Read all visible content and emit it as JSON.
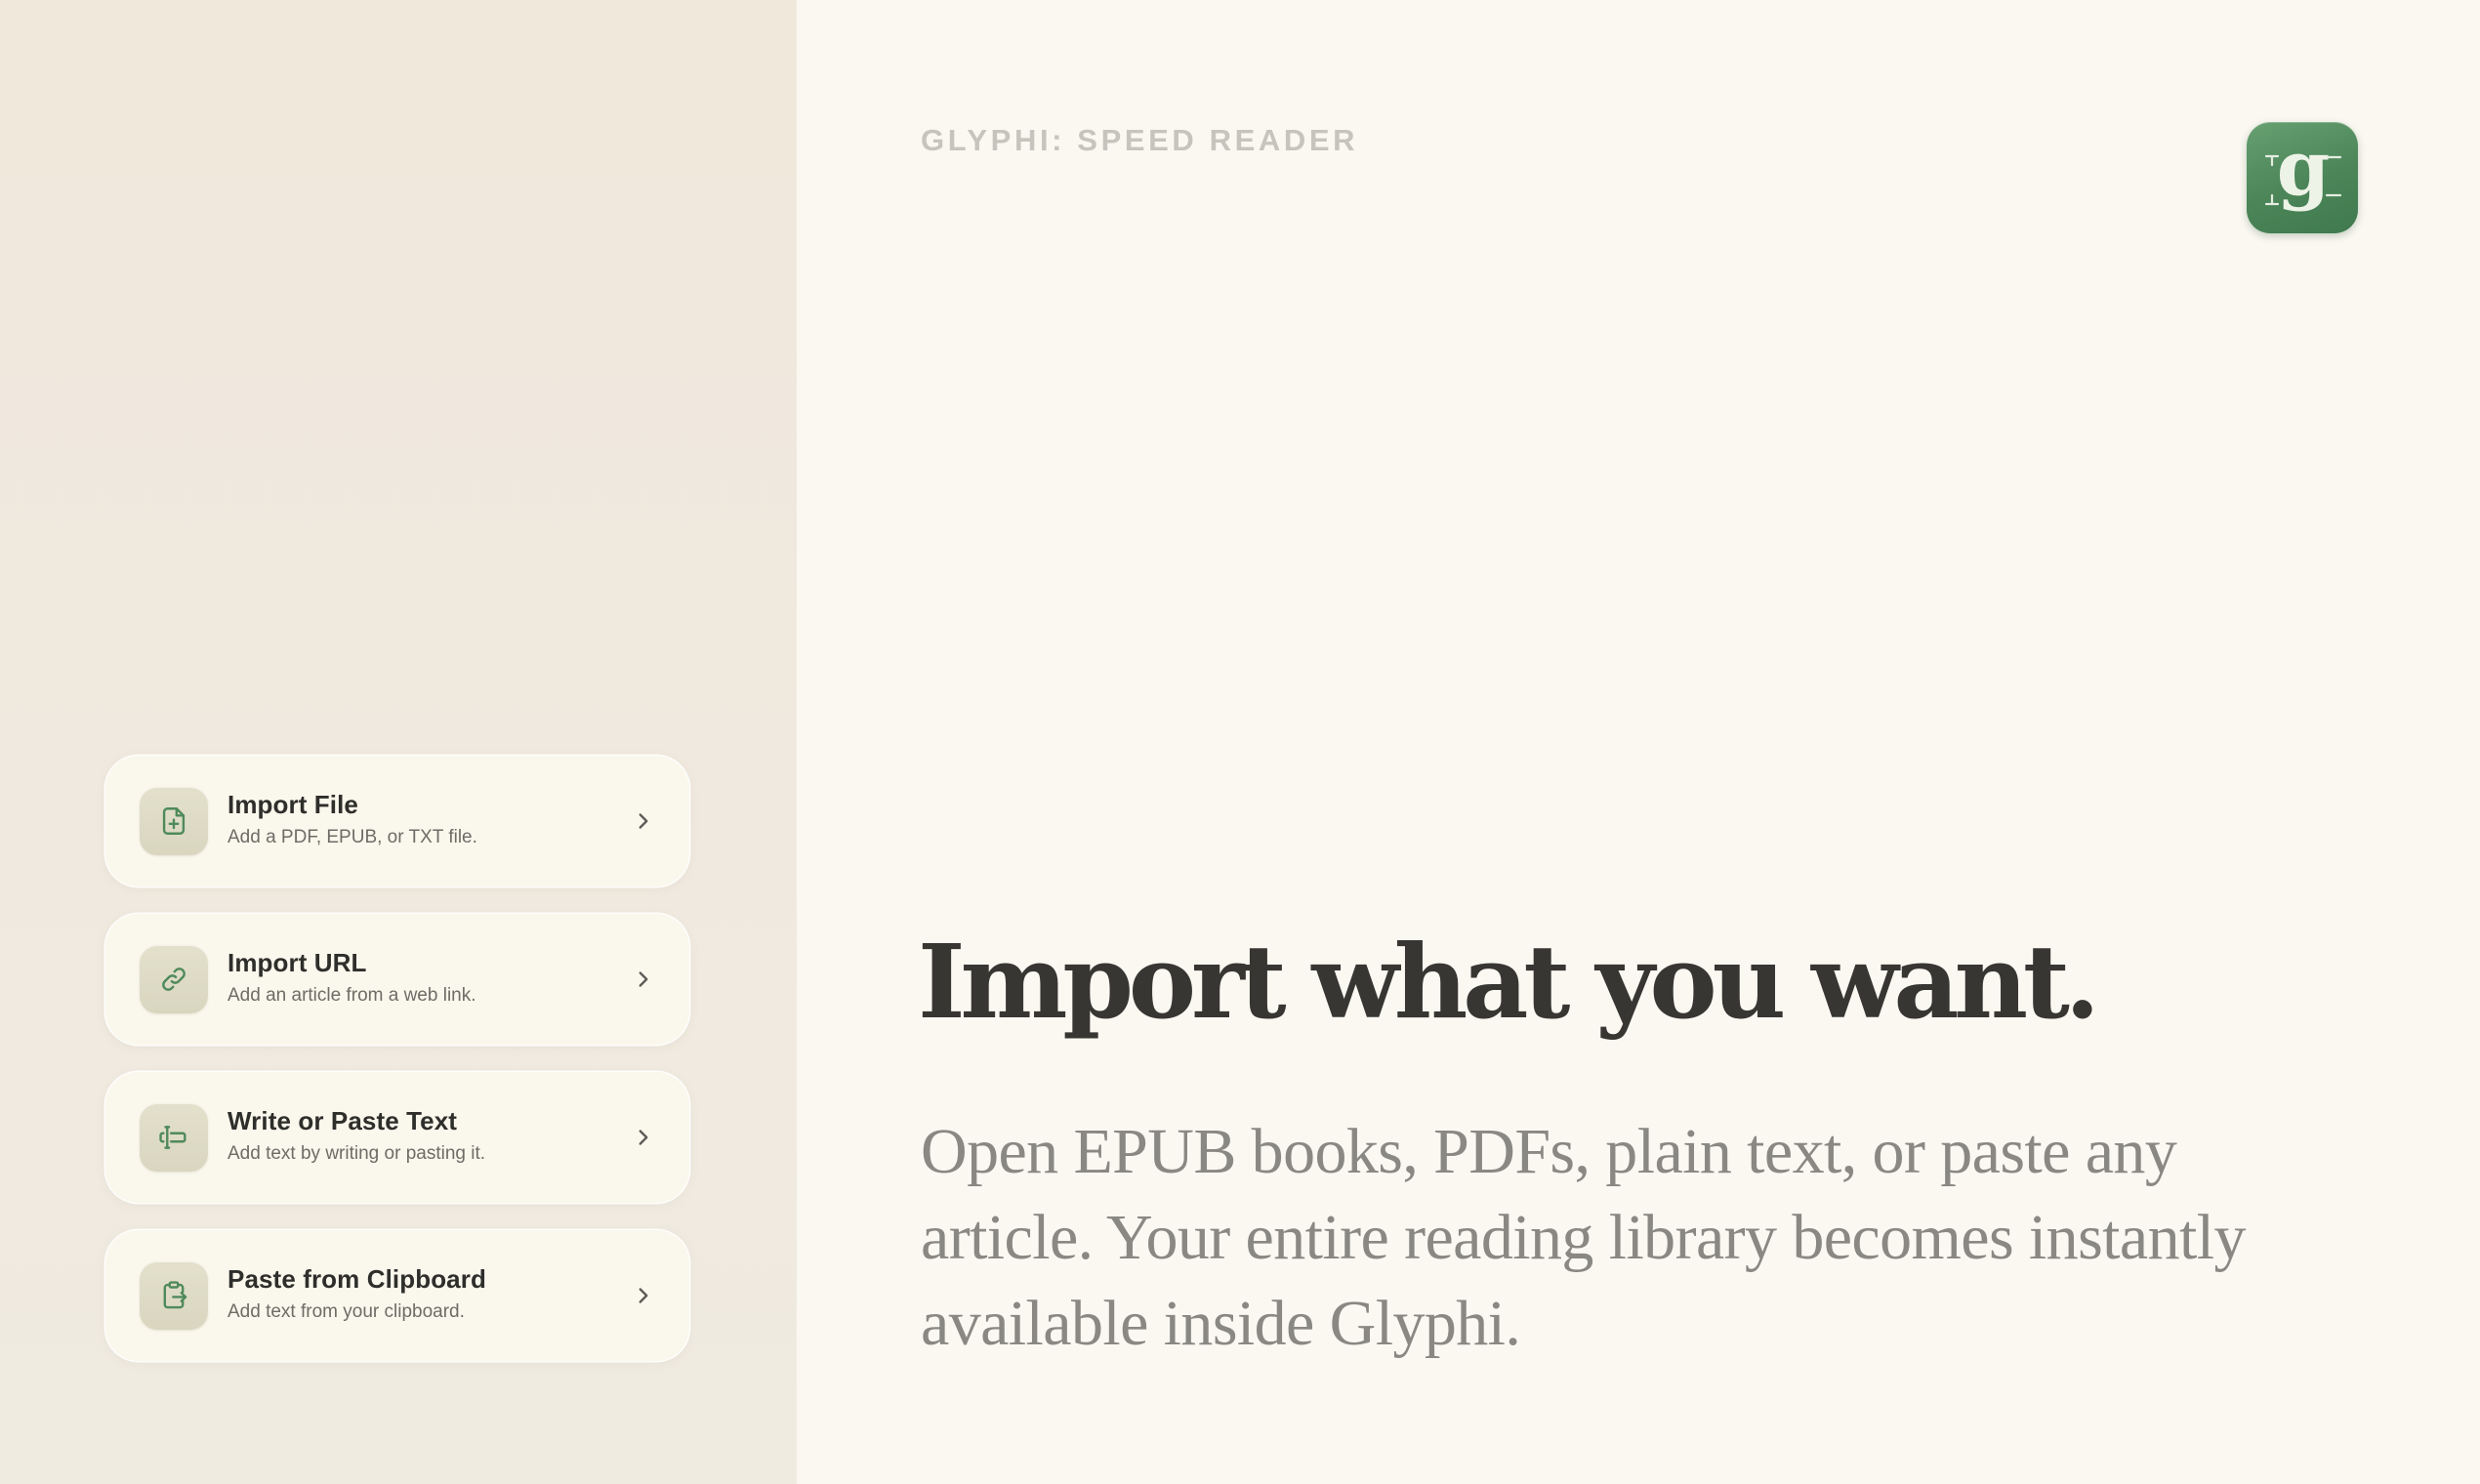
{
  "app": {
    "title": "GLYPHI: SPEED READER",
    "logo_letter": "g",
    "logo_color": "#4b8558"
  },
  "import_options": [
    {
      "title": "Import File",
      "subtitle": "Add a PDF, EPUB, or TXT file.",
      "icon": "file-plus-icon"
    },
    {
      "title": "Import URL",
      "subtitle": "Add an article from a web link.",
      "icon": "link-icon"
    },
    {
      "title": "Write or Paste Text",
      "subtitle": "Add text by writing or pasting it.",
      "icon": "text-cursor-icon"
    },
    {
      "title": "Paste from Clipboard",
      "subtitle": "Add text from your clipboard.",
      "icon": "clipboard-paste-icon"
    }
  ],
  "main": {
    "headline": "Import what you want.",
    "description": "Open EPUB books, PDFs, plain text, or paste any article. Your entire reading library becomes instantly available inside Glyphi."
  },
  "colors": {
    "accent_green": "#4f8a5b",
    "left_panel_bg": "#f0e9df",
    "right_panel_bg": "#faf8f1",
    "card_bg": "#faf7ec",
    "headline_text": "#373633",
    "body_text": "#8a8882"
  }
}
